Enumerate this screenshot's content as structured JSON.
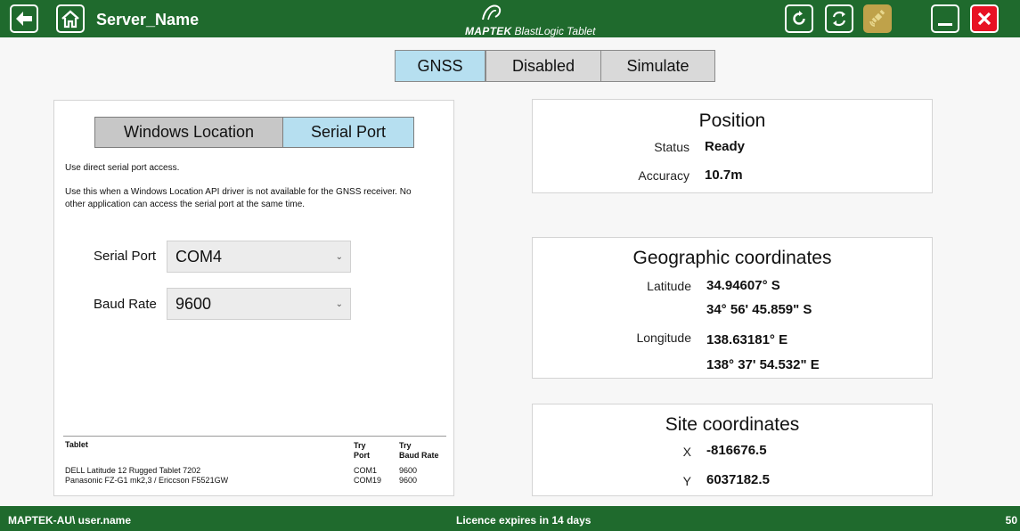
{
  "header": {
    "server_name": "Server_Name",
    "brand_name": "MAPTEK",
    "product_name": "BlastLogic Tablet",
    "colors": {
      "bar": "#1f6a2d",
      "close": "#e81123",
      "satellite": "#bfa24a"
    },
    "icons": [
      "back-arrow-icon",
      "home-icon",
      "refresh-icon",
      "sync-icon",
      "satellite-icon",
      "minimize-icon",
      "close-icon"
    ]
  },
  "mode_tabs": {
    "gnss": "GNSS",
    "disabled": "Disabled",
    "simulate": "Simulate",
    "selected": "GNSS"
  },
  "source": {
    "windows_location": "Windows Location",
    "serial_port": "Serial Port",
    "selected": "Serial Port",
    "desc1": "Use direct serial port access.",
    "desc2_line1": "Use this when a Windows Location API driver is not available for the GNSS receiver. No",
    "desc2_line2": "other application can access the serial port at the same time."
  },
  "fields": {
    "serial_port_label": "Serial Port",
    "serial_port_value": "COM4",
    "baud_rate_label": "Baud Rate",
    "baud_rate_value": "9600"
  },
  "tablet_table": {
    "headers": {
      "tablet": "Tablet",
      "port_1": "Try",
      "port_2": "Port",
      "baud_1": "Try",
      "baud_2": "Baud Rate"
    },
    "rows": [
      {
        "tablet": "DELL Latitude 12 Rugged Tablet 7202",
        "port": "COM1",
        "baud": "9600"
      },
      {
        "tablet": "Panasonic FZ-G1 mk2,3 / Ericcson F5521GW",
        "port": "COM19",
        "baud": "9600"
      }
    ]
  },
  "position": {
    "title": "Position",
    "status_label": "Status",
    "status_value": "Ready",
    "accuracy_label": "Accuracy",
    "accuracy_value": "10.7m"
  },
  "geographic": {
    "title": "Geographic coordinates",
    "latitude_label": "Latitude",
    "latitude_decimal": "34.94607°  S",
    "latitude_dms": "34° 56' 45.859\" S",
    "longitude_label": "Longitude",
    "longitude_decimal": "138.63181°  E",
    "longitude_dms": "138° 37' 54.532\" E"
  },
  "site": {
    "title": "Site coordinates",
    "x_label": "X",
    "x_value": "-816676.5",
    "y_label": "Y",
    "y_value": "6037182.5"
  },
  "footer": {
    "user": "MAPTEK-AU\\ user.name",
    "licence": "Licence expires in 14 days",
    "right": "50"
  }
}
